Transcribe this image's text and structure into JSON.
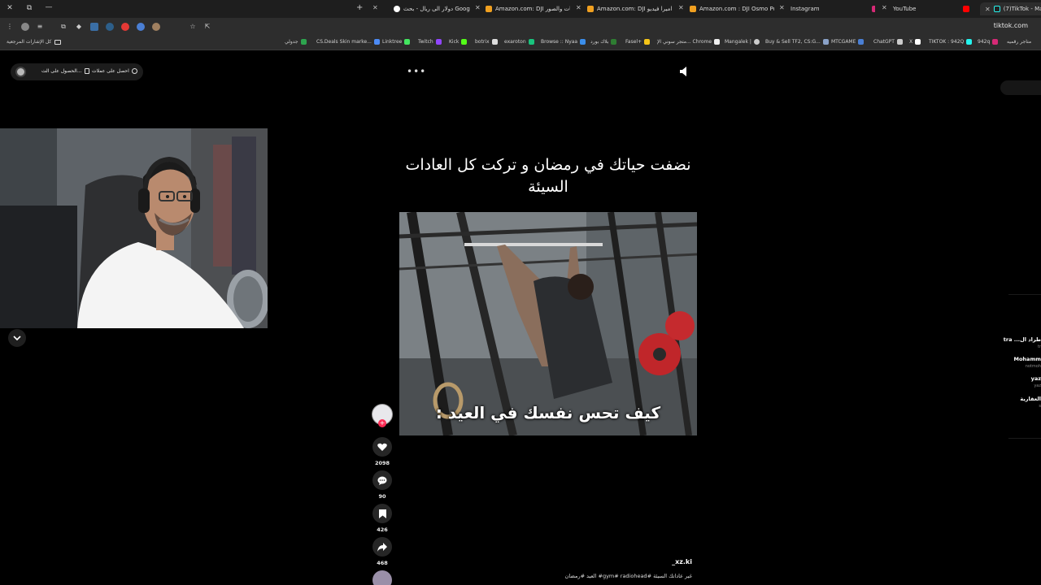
{
  "browser": {
    "tabs": [
      {
        "label": "دولار الى ريال - بحث Google",
        "color": "#ffffff"
      },
      {
        "label": "Amazon.com: DJI منتجات والصور",
        "color": "#f0a020"
      },
      {
        "label": "Amazon.com: DJI كاميرا فيديو",
        "color": "#f0a020"
      },
      {
        "label": "Amazon.com : DJI Osmo Pocke",
        "color": "#f0a020"
      },
      {
        "label": "Instagram",
        "color": "#d62976"
      },
      {
        "label": "YouTube",
        "color": "#ff0000"
      },
      {
        "label": "(7)TikTok - Make",
        "color": "#25f4ee"
      }
    ],
    "url": "tiktok.com",
    "bookmarks_folder": "كل الإشارات المرجعية",
    "bookmarks": [
      {
        "label": "جدولي",
        "color": "#2da44e"
      },
      {
        "label": "CS.Deals Skin marke...",
        "color": "#4c8bf5"
      },
      {
        "label": "Linktree",
        "color": "#43e660"
      },
      {
        "label": "Twitch",
        "color": "#9146ff"
      },
      {
        "label": "Kick",
        "color": "#53fc18"
      },
      {
        "label": "botrix",
        "color": "#dddddd"
      },
      {
        "label": "exaroton",
        "color": "#19c37d"
      },
      {
        "label": "Browse :: Nyaa",
        "color": "#3b8eea"
      },
      {
        "label": "بلاك بورد",
        "color": "#2e7d32"
      },
      {
        "label": "Fasel+",
        "color": "#f5c518"
      },
      {
        "label": "متجر سوني الإ... Chrome",
        "color": "#eeeeee"
      },
      {
        "label": "Mangalek |",
        "color": "#cccccc"
      },
      {
        "label": "Buy & Sell TF2, CS:G...",
        "color": "#8aa2c8"
      },
      {
        "label": "MTCGAME",
        "color": "#4a7fd4"
      },
      {
        "label": "ChatGPT",
        "color": "#cccccc"
      },
      {
        "label": "X",
        "color": "#ffffff"
      },
      {
        "label": "TIKTOK : 942Q",
        "color": "#25f4ee"
      },
      {
        "label": "942q",
        "color": "#d62976"
      },
      {
        "label": "متاجر رقميه",
        "color": "#999999"
      }
    ]
  },
  "page": {
    "get_app": "الحصول على الت...",
    "get_coins": "احصل على عملات",
    "caption": "نضفت حياتك في رمضان و تركت كل العادات السيئة",
    "video_subtitle": "كيف تحس نفسك في العيد :",
    "likes": "2098",
    "comments": "90",
    "saves": "426",
    "shares": "468",
    "username": "_xz.ki",
    "description": "غير عاداتك السيئة #gym# radiohead# العيد #رمضان"
  },
  "comments_sliver": [
    {
      "name": "طراد ال... tra",
      "sub": "tr"
    },
    {
      "name": "Mohamm",
      "sub": "notmoh"
    },
    {
      "name": "yaz",
      "sub": "yaz"
    },
    {
      "name": "العقارية",
      "sub": "s"
    }
  ],
  "colors": {
    "accent": "#fe2c55",
    "bg": "#000000"
  }
}
